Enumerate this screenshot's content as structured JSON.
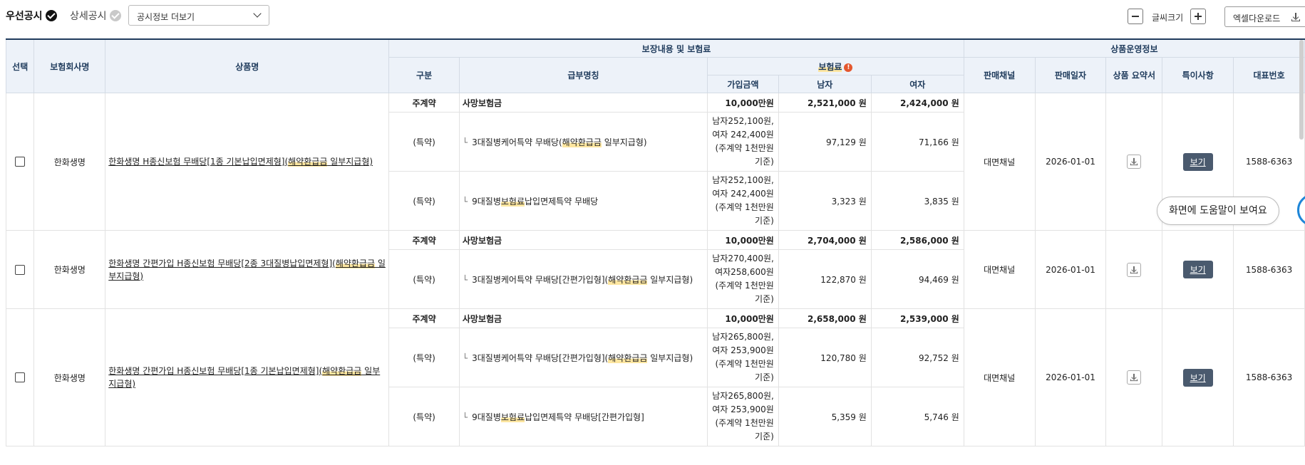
{
  "tabs": {
    "priority": "우선공시",
    "detail": "상세공시"
  },
  "dropdown": {
    "label": "공시정보 더보기"
  },
  "toolbar": {
    "font_size_label": "글씨크기",
    "excel_label": "엑셀다운로드"
  },
  "table": {
    "headers": {
      "select": "선택",
      "company": "보험회사명",
      "product": "상품명",
      "coverage_group": "보장내용 및 보험료",
      "ops_group": "상품운영정보",
      "category": "구분",
      "benefit": "급부명칭",
      "premium": "보험료",
      "premium_warn": "!",
      "amount": "가입금액",
      "male": "남자",
      "female": "여자",
      "channel": "판매채널",
      "sale_date": "판매일자",
      "summary": "상품 요약서",
      "notes": "특이사항",
      "phone": "대표번호"
    },
    "products": [
      {
        "company": "한화생명",
        "name_a": "한화생명 H종신보험 무배당[1종 기본납입면제형](",
        "name_hl": "해약환급금",
        "name_b": " 일부지급형)",
        "channel": "대면채널",
        "date": "2026-01-01",
        "view": "보기",
        "phone": "1588-6363",
        "main": {
          "category": "주계약",
          "benefit": "사망보험금",
          "amount": "10,000만원",
          "male": "2,521,000 원",
          "female": "2,424,000 원"
        },
        "riders": [
          {
            "category": "(특약)",
            "branch": "└",
            "benefit_a": "3대질병케어특약 무배당(",
            "benefit_hl": "해약환급금",
            "benefit_b": " 일부지급형)",
            "amount": "남자252,100원, 여자 242,400원 (주계약 1천만원기준)",
            "male": "97,129 원",
            "female": "71,166 원"
          },
          {
            "category": "(특약)",
            "branch": "└",
            "benefit_a": "9대질병",
            "benefit_hl": "보험료",
            "benefit_b": "납입면제특약 무배당",
            "amount": "남자252,100원, 여자 242,400원 (주계약 1천만원기준)",
            "male": "3,323 원",
            "female": "3,835 원"
          }
        ]
      },
      {
        "company": "한화생명",
        "name_a": "한화생명 간편가입 H종신보험 무배당[2종 3대질병납입면제형](",
        "name_hl": "해약환급금",
        "name_b": " 일부지급형)",
        "channel": "대면채널",
        "date": "2026-01-01",
        "view": "보기",
        "phone": "1588-6363",
        "main": {
          "category": "주계약",
          "benefit": "사망보험금",
          "amount": "10,000만원",
          "male": "2,704,000 원",
          "female": "2,586,000 원"
        },
        "riders": [
          {
            "category": "(특약)",
            "branch": "└",
            "benefit_a": "3대질병케어특약 무배당[간편가입형](",
            "benefit_hl": "해약환급금",
            "benefit_b": " 일부지급형)",
            "amount": "남자270,400원, 여자258,600원 (주계약 1천만원 기준)",
            "male": "122,870 원",
            "female": "94,469 원"
          }
        ]
      },
      {
        "company": "한화생명",
        "name_a": "한화생명 간편가입 H종신보험 무배당[1종 기본납입면제형](",
        "name_hl": "해약환급금",
        "name_b": " 일부지급형)",
        "channel": "대면채널",
        "date": "2026-01-01",
        "view": "보기",
        "phone": "1588-6363",
        "main": {
          "category": "주계약",
          "benefit": "사망보험금",
          "amount": "10,000만원",
          "male": "2,658,000 원",
          "female": "2,539,000 원"
        },
        "riders": [
          {
            "category": "(특약)",
            "branch": "└",
            "benefit_a": "3대질병케어특약 무배당[간편가입형](",
            "benefit_hl": "해약환급금",
            "benefit_b": " 일부지급형)",
            "amount": "남자265,800원, 여자 253,900원 (주계약 1천만원기준)",
            "male": "120,780 원",
            "female": "92,752 원"
          },
          {
            "category": "(특약)",
            "branch": "└",
            "benefit_a": "9대질병",
            "benefit_hl": "보험료",
            "benefit_b": "납입면제특약 무배당[간편가입형]",
            "amount": "남자265,800원, 여자 253,900원 (주계약 1천만원기준)",
            "male": "5,359 원",
            "female": "5,746 원"
          }
        ]
      }
    ]
  },
  "help": {
    "tooltip": "화면에 도움말이 보여요"
  },
  "colors": {
    "header_bg": "#edf2f9",
    "header_text": "#1f3b5c",
    "highlight": "#fde6a0",
    "view_button": "#4a5a6e",
    "help_ring": "#1e86d8"
  }
}
